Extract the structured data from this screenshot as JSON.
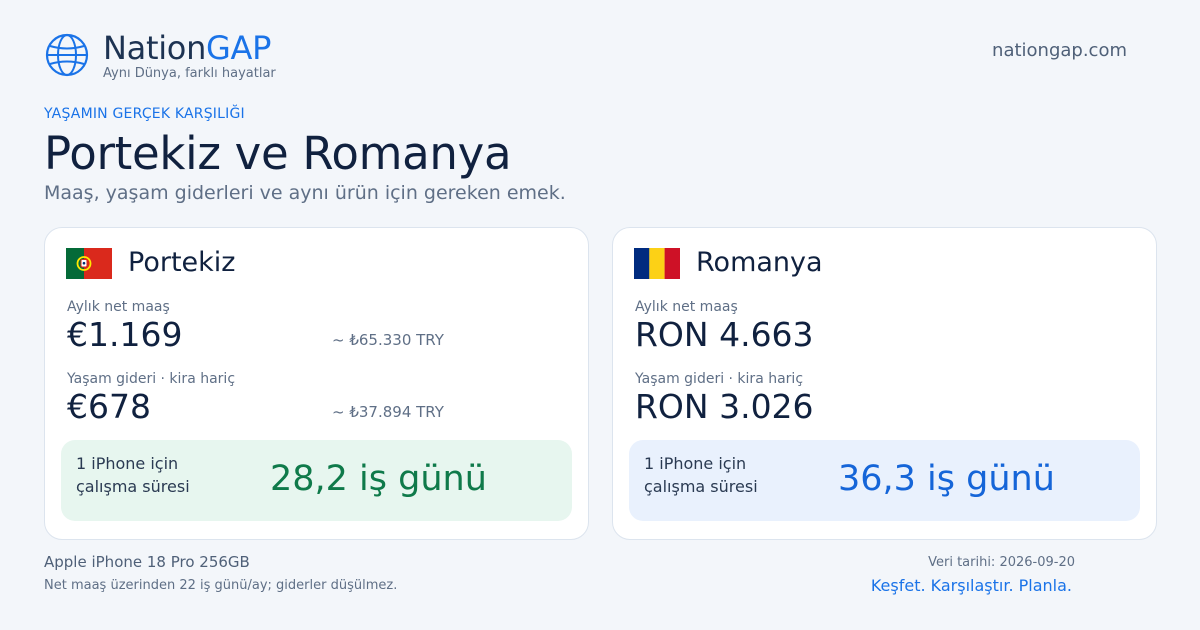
{
  "header": {
    "brand_part1": "Nation",
    "brand_part2": "GAP",
    "tagline": "Aynı Dünya, farklı hayatlar",
    "site": "nationgap.com",
    "logo_icon": "globe-icon"
  },
  "hero": {
    "eyebrow": "YAŞAMIN GERÇEK KARŞILIĞI",
    "title": "Portekiz ve Romanya",
    "subtitle": "Maaş, yaşam giderleri ve aynı ürün için gereken emek."
  },
  "cards": [
    {
      "country": "Portekiz",
      "flag_icon": "portugal-flag-icon",
      "salary_label": "Aylık net maaş",
      "salary_value": "€1.169",
      "salary_converted": "~ ₺65.330 TRY",
      "cost_label": "Yaşam gideri · kira hariç",
      "cost_value": "€678",
      "cost_converted": "~ ₺37.894 TRY",
      "work_label_line1": "1 iPhone için",
      "work_label_line2": "çalışma süresi",
      "work_value": "28,2 iş günü",
      "accent_color": "#0f7a4a"
    },
    {
      "country": "Romanya",
      "flag_icon": "romania-flag-icon",
      "salary_label": "Aylık net maaş",
      "salary_value": "RON 4.663",
      "cost_label": "Yaşam gideri · kira hariç",
      "cost_value": "RON 3.026",
      "work_label_line1": "1 iPhone için",
      "work_label_line2": "çalışma süresi",
      "work_value": "36,3 iş günü",
      "accent_color": "#1565d8"
    }
  ],
  "footer": {
    "product": "Apple iPhone 18 Pro 256GB",
    "note": "Net maaş üzerinden 22 iş günü/ay; giderler düşülmez.",
    "date": "Veri tarihi: 2026-09-20",
    "cta": "Keşfet. Karşılaştır. Planla."
  },
  "colors": {
    "background": "#f3f6fa",
    "brand_blue": "#1a73e8",
    "text_dark": "#10213f",
    "text_muted": "#5f6f86"
  }
}
